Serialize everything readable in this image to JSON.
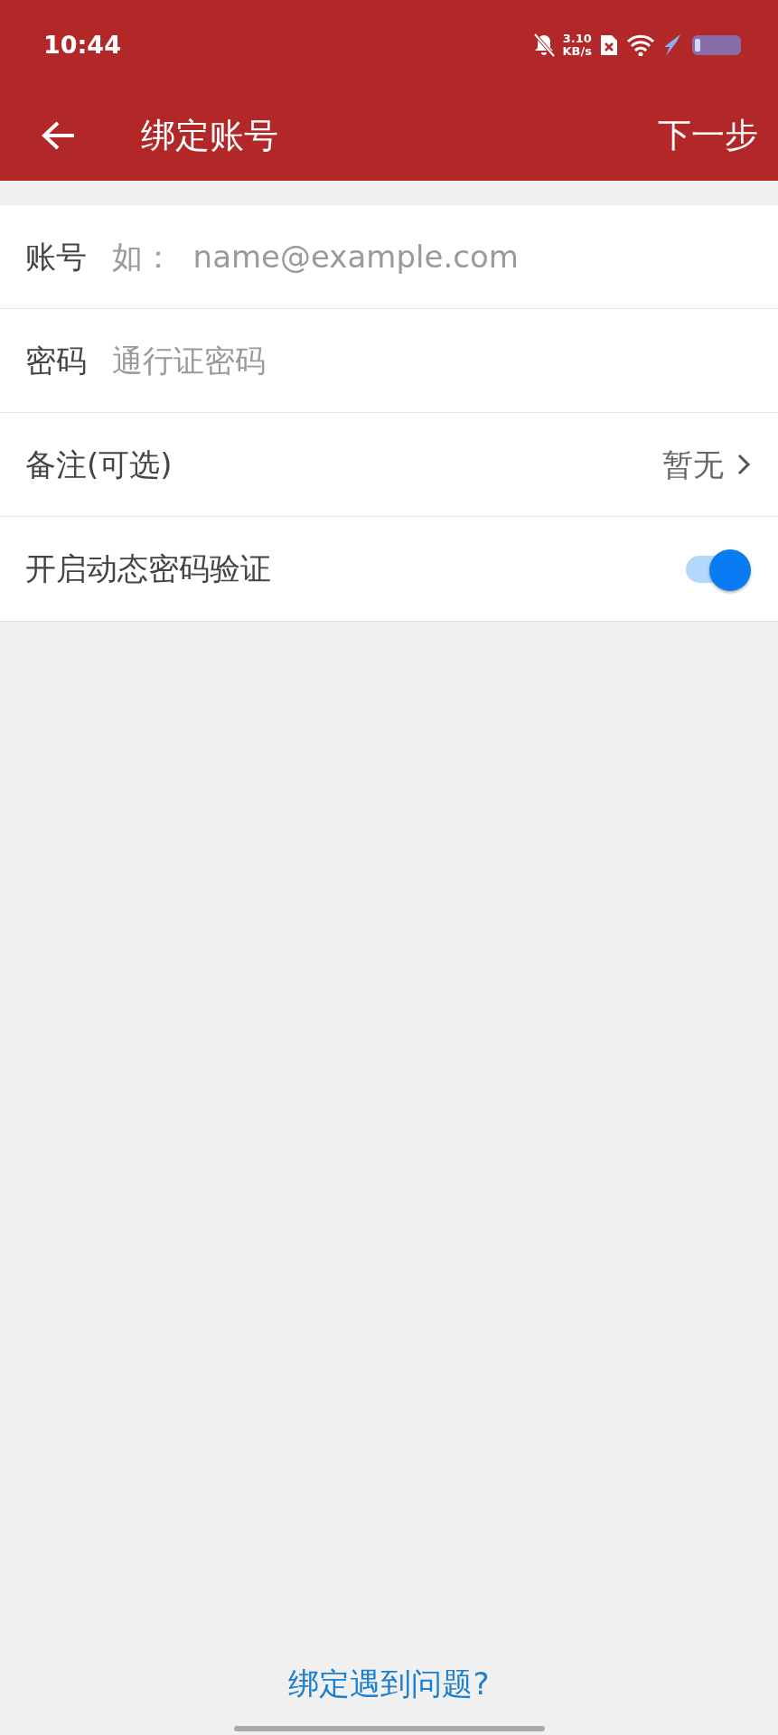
{
  "status_bar": {
    "time": "10:44",
    "net_speed_value": "3.10",
    "net_speed_unit": "KB/s"
  },
  "app_bar": {
    "title": "绑定账号",
    "action": "下一步"
  },
  "form": [
    {
      "kind": "input",
      "label": "账号",
      "placeholder": "如：  name@example.com"
    },
    {
      "kind": "input",
      "label": "密码",
      "placeholder": "通行证密码"
    },
    {
      "kind": "link",
      "label": "备注(可选)",
      "value": "暂无"
    },
    {
      "kind": "toggle",
      "label": "开启动态密码验证",
      "on": true
    }
  ],
  "help_link": "绑定遇到问题?"
}
